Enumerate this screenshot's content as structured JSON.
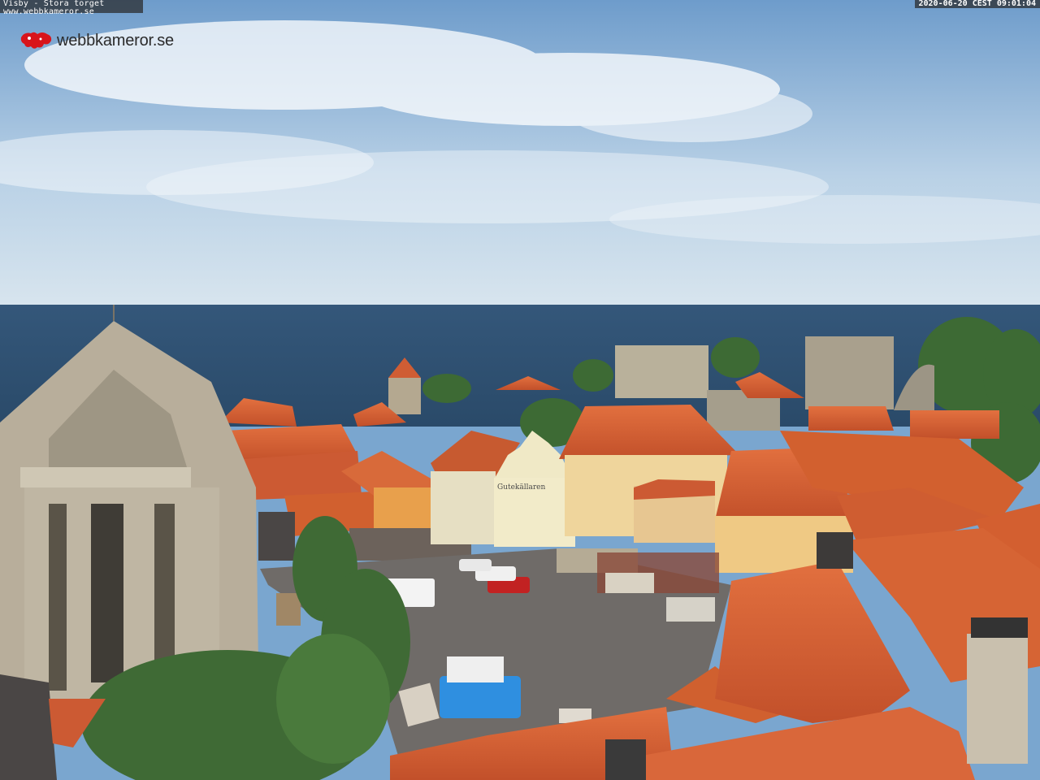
{
  "overlay": {
    "caption_line1": "Visby - Stora torget",
    "caption_line2": "www.webbkameror.se",
    "timestamp": "2020-06-20 CEST 09:01:04"
  },
  "logo": {
    "text": "webbkameror.se",
    "color": "#d8141b"
  },
  "signage": {
    "building_sign": "Gutekällaren"
  },
  "colors": {
    "sky_top": "#6f9fd0",
    "sky_horizon": "#dbe8f1",
    "sea": "#2b4f72",
    "roof": "#d8643a",
    "stone": "#b7ad98",
    "pavement": "#6f6b68",
    "tree": "#3f6a35"
  }
}
